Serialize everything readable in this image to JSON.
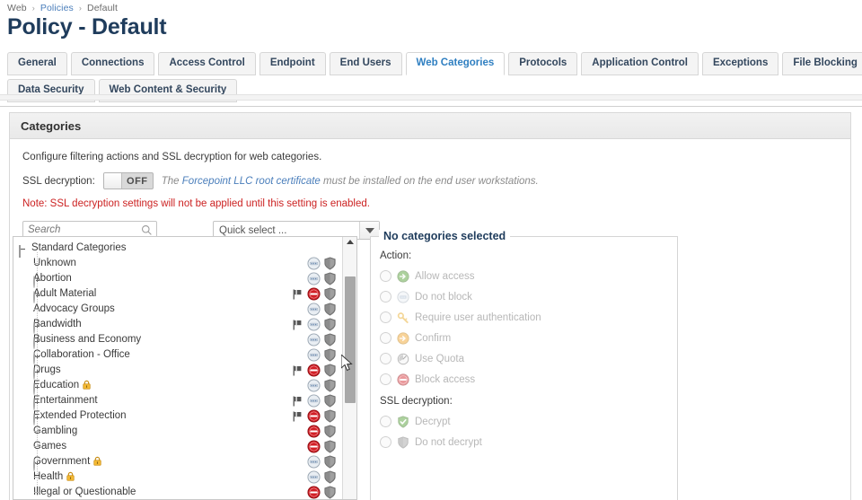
{
  "breadcrumb": {
    "root": "Web",
    "link": "Policies",
    "current": "Default",
    "sep": "›"
  },
  "page_title": "Policy - Default",
  "tabs_row1": [
    {
      "label": "General",
      "active": false
    },
    {
      "label": "Connections",
      "active": false
    },
    {
      "label": "Access Control",
      "active": false
    },
    {
      "label": "Endpoint",
      "active": false
    },
    {
      "label": "End Users",
      "active": false
    },
    {
      "label": "Web Categories",
      "active": true
    },
    {
      "label": "Protocols",
      "active": false
    },
    {
      "label": "Application Control",
      "active": false
    },
    {
      "label": "Exceptions",
      "active": false
    },
    {
      "label": "File Blocking",
      "active": false
    }
  ],
  "tabs_row2": [
    {
      "label": "Data Security",
      "active": false
    },
    {
      "label": "Web Content & Security",
      "active": false
    }
  ],
  "panel": {
    "heading": "Categories",
    "description": "Configure filtering actions and SSL decryption for web categories.",
    "ssl_label": "SSL decryption:",
    "toggle_state": "OFF",
    "note_prefix": "The ",
    "note_link": "Forcepoint LLC root certificate",
    "note_suffix": " must be installed on the end user workstations.",
    "warning": "Note: SSL decryption settings will not be applied until this setting is enabled."
  },
  "search": {
    "placeholder": "Search",
    "value": "",
    "icon": "search-icon"
  },
  "quick_select": {
    "label": "Quick select ...",
    "icon": "chevron-down-icon"
  },
  "tree": {
    "root": {
      "label": "Standard Categories",
      "toggle": "minus-box",
      "icons": []
    },
    "items": [
      {
        "label": "Unknown",
        "toggle": "leaf",
        "lock": false,
        "flag": false,
        "action": "do-not-block",
        "ssl": "do-not-decrypt"
      },
      {
        "label": "Abortion",
        "toggle": "plus",
        "lock": false,
        "flag": false,
        "action": "do-not-block",
        "ssl": "do-not-decrypt"
      },
      {
        "label": "Adult Material",
        "toggle": "plus",
        "lock": false,
        "flag": true,
        "action": "block",
        "ssl": "do-not-decrypt"
      },
      {
        "label": "Advocacy Groups",
        "toggle": "leaf",
        "lock": false,
        "flag": false,
        "action": "do-not-block",
        "ssl": "do-not-decrypt"
      },
      {
        "label": "Bandwidth",
        "toggle": "plus",
        "lock": false,
        "flag": true,
        "action": "do-not-block",
        "ssl": "do-not-decrypt"
      },
      {
        "label": "Business and Economy",
        "toggle": "plus",
        "lock": false,
        "flag": false,
        "action": "do-not-block",
        "ssl": "do-not-decrypt"
      },
      {
        "label": "Collaboration - Office",
        "toggle": "plus",
        "lock": false,
        "flag": false,
        "action": "do-not-block",
        "ssl": "do-not-decrypt"
      },
      {
        "label": "Drugs",
        "toggle": "plus",
        "lock": false,
        "flag": true,
        "action": "block",
        "ssl": "do-not-decrypt"
      },
      {
        "label": "Education",
        "toggle": "plus",
        "lock": true,
        "flag": false,
        "action": "do-not-block",
        "ssl": "do-not-decrypt"
      },
      {
        "label": "Entertainment",
        "toggle": "plus",
        "lock": false,
        "flag": true,
        "action": "do-not-block",
        "ssl": "do-not-decrypt"
      },
      {
        "label": "Extended Protection",
        "toggle": "plus",
        "lock": false,
        "flag": true,
        "action": "block",
        "ssl": "do-not-decrypt"
      },
      {
        "label": "Gambling",
        "toggle": "leaf",
        "lock": false,
        "flag": false,
        "action": "block",
        "ssl": "do-not-decrypt"
      },
      {
        "label": "Games",
        "toggle": "leaf",
        "lock": false,
        "flag": false,
        "action": "block",
        "ssl": "do-not-decrypt"
      },
      {
        "label": "Government",
        "toggle": "plus",
        "lock": true,
        "flag": false,
        "action": "do-not-block",
        "ssl": "do-not-decrypt"
      },
      {
        "label": "Health",
        "toggle": "leaf",
        "lock": true,
        "flag": false,
        "action": "do-not-block",
        "ssl": "do-not-decrypt"
      },
      {
        "label": "Illegal or Questionable",
        "toggle": "leaf",
        "lock": false,
        "flag": false,
        "action": "block",
        "ssl": "do-not-decrypt"
      }
    ],
    "scrollbar": {
      "thumb_top_pct": 15,
      "thumb_height_pct": 48
    }
  },
  "details": {
    "legend": "No categories selected",
    "action_label": "Action:",
    "actions": [
      {
        "label": "Allow access",
        "icon": "allow-icon",
        "selected": false
      },
      {
        "label": "Do not block",
        "icon": "do-not-block-icon",
        "selected": false
      },
      {
        "label": "Require user authentication",
        "icon": "key-icon",
        "selected": false
      },
      {
        "label": "Confirm",
        "icon": "confirm-icon",
        "selected": false
      },
      {
        "label": "Use Quota",
        "icon": "quota-icon",
        "selected": false
      },
      {
        "label": "Block access",
        "icon": "block-icon",
        "selected": false
      }
    ],
    "ssl_label": "SSL decryption:",
    "ssl_options": [
      {
        "label": "Decrypt",
        "icon": "shield-check-icon",
        "selected": false
      },
      {
        "label": "Do not decrypt",
        "icon": "shield-gray-icon",
        "selected": false
      }
    ]
  },
  "colors": {
    "accent": "#2f7fc1",
    "title": "#1f3c5c",
    "warning": "#cc2222",
    "allow_green": "#4a9a28",
    "block_red": "#cc2127",
    "confirm_orange": "#f0a020",
    "link": "#4a7ebb"
  }
}
